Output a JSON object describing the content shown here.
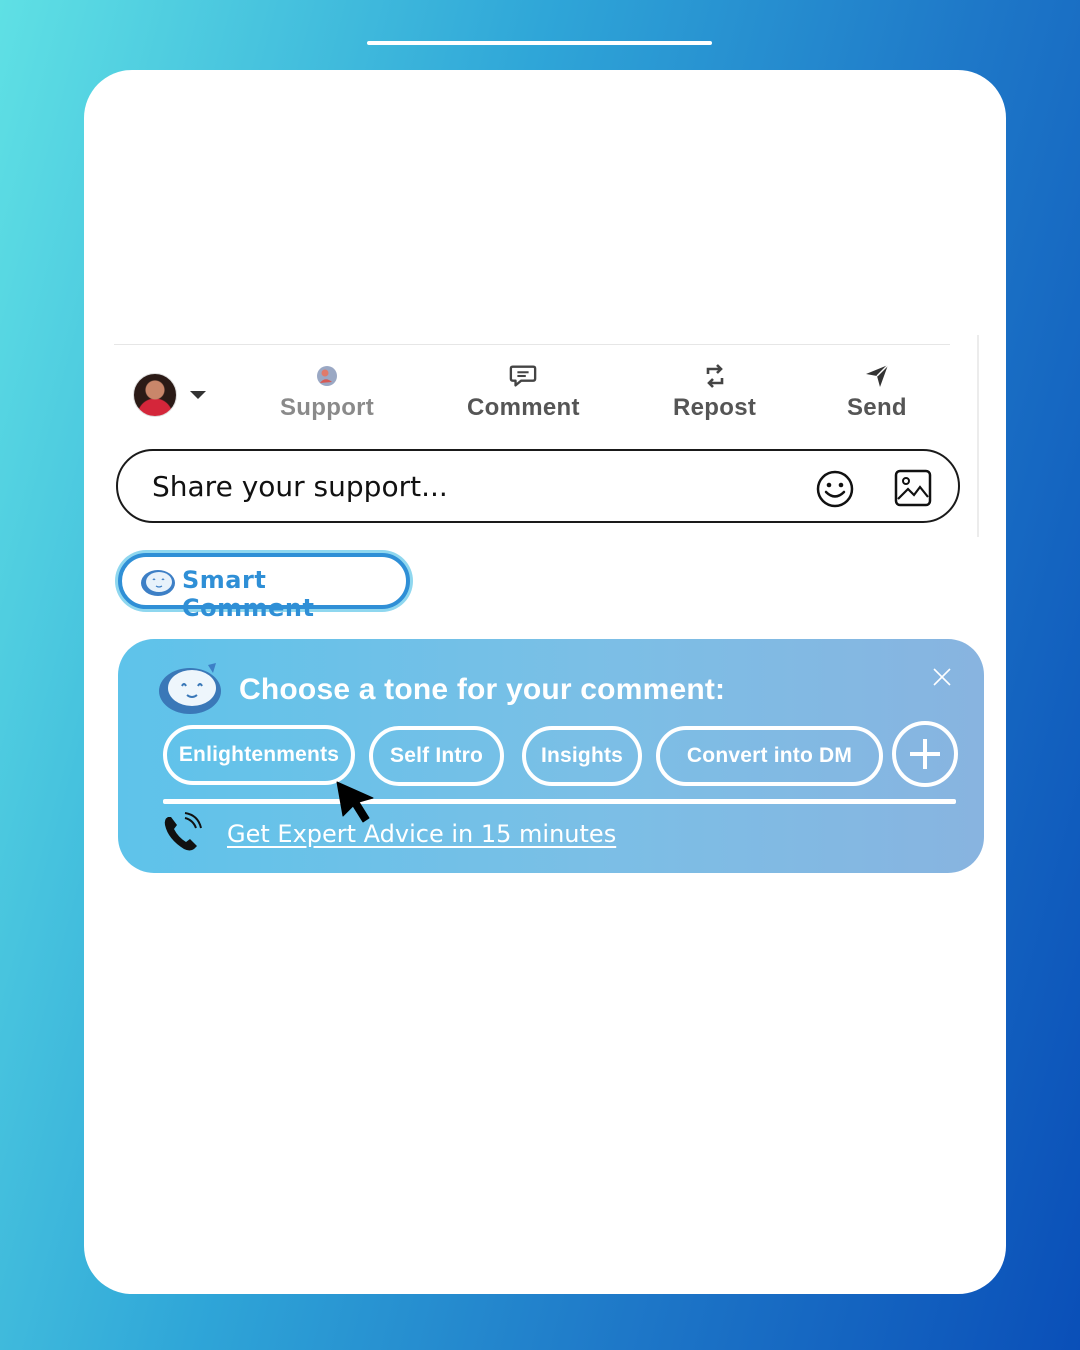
{
  "actions": {
    "support_label": "Support",
    "comment_label": "Comment",
    "repost_label": "Repost",
    "send_label": "Send"
  },
  "share_input": {
    "placeholder": "Share your support..."
  },
  "smart_comment": {
    "label": "Smart Comment",
    "accent": "#2f8fd6"
  },
  "tone_panel": {
    "title": "Choose a tone for your comment:",
    "tones": [
      "Enlightenments",
      "Self Intro",
      "Insights",
      "Convert into DM"
    ],
    "expert_link": "Get Expert Advice in 15 minutes"
  },
  "icons": [
    "avatar",
    "caret-down-icon",
    "support-icon",
    "comment-icon",
    "repost-icon",
    "send-icon",
    "emoji-icon",
    "image-icon",
    "mascot-icon",
    "close-icon",
    "plus-icon",
    "phone-icon",
    "cursor-icon"
  ],
  "colors": {
    "background_start": "#5fe0e4",
    "background_end": "#0a4fb8",
    "panel": "#6fc0e8"
  }
}
